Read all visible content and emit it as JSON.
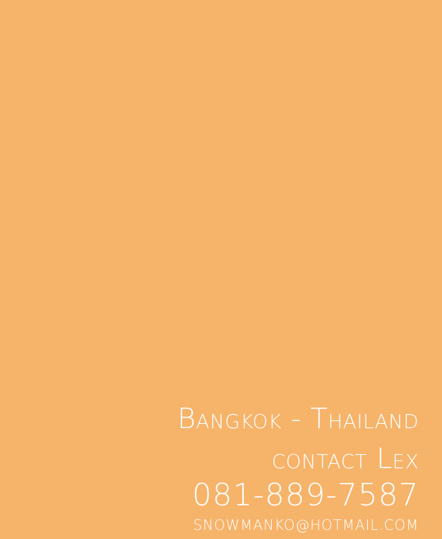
{
  "card": {
    "background_color": "#f6b36a",
    "text_color": "#ffffff",
    "location": "Bangkok - Thailand",
    "contact_line": "contact Lex",
    "phone": "081-889-7587",
    "email": "SNOWMANKO@HOTMAIL.COM"
  }
}
